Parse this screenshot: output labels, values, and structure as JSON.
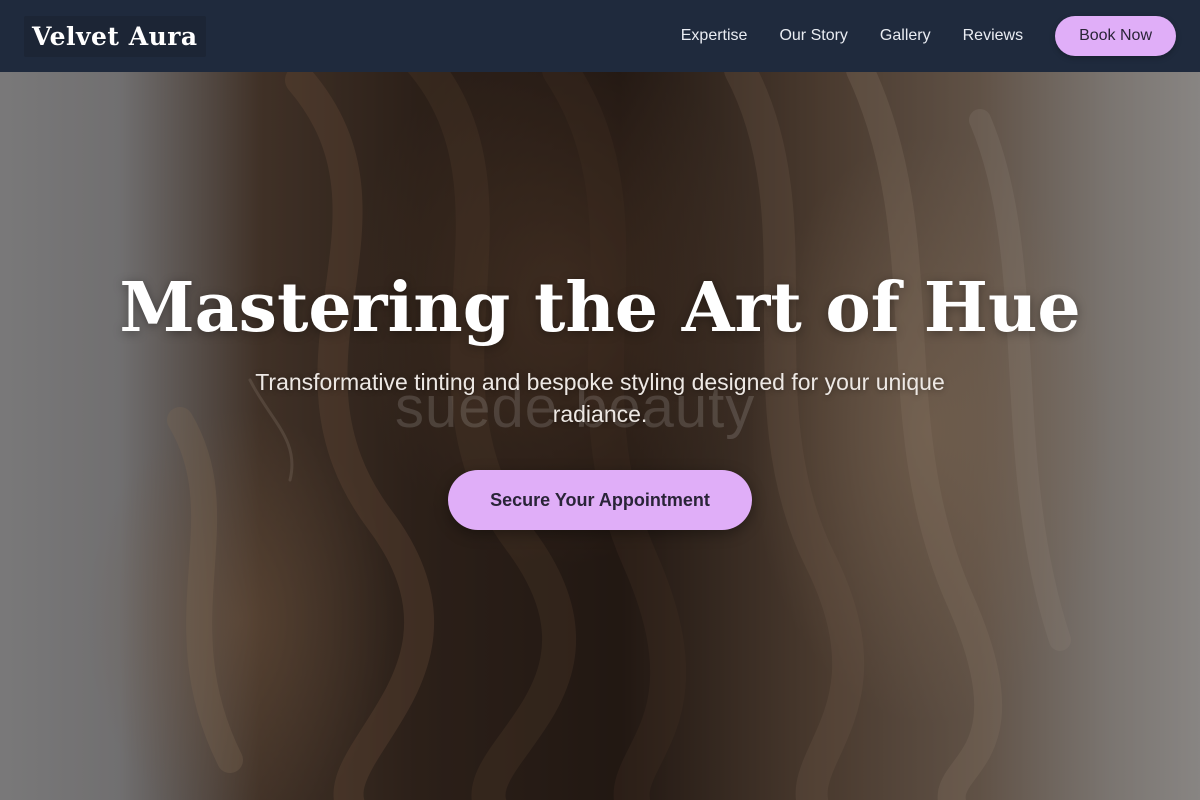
{
  "brand": {
    "name": "Velvet Aura"
  },
  "nav": {
    "links": [
      {
        "label": "Expertise"
      },
      {
        "label": "Our Story"
      },
      {
        "label": "Gallery"
      },
      {
        "label": "Reviews"
      }
    ],
    "cta_label": "Book Now"
  },
  "hero": {
    "title": "Mastering the Art of Hue",
    "subtitle": "Transformative tinting and bespoke styling designed for your unique radiance.",
    "watermark": "suede beauty",
    "cta_label": "Secure Your Appointment"
  },
  "colors": {
    "header_bg": "#1f2a3d",
    "accent": "#e0aef8",
    "accent_text": "#2a2438"
  }
}
